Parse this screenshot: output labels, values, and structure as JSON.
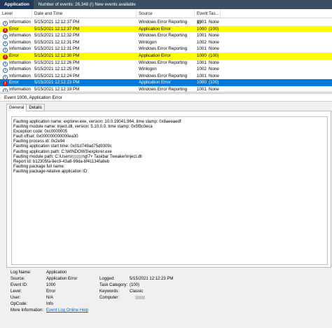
{
  "topbar": {
    "name": "Application",
    "info": "Number of events: 26,348 (!) New events available"
  },
  "columns": {
    "level": "Level",
    "date": "Date and Time",
    "source": "Source",
    "event_id": "Event ID",
    "task": "Tas..."
  },
  "events": [
    {
      "level": "Information",
      "icon": "info-icon",
      "date": "5/15/2021 12:12:37 PM",
      "source": "Windows Error Reporting",
      "id": "1001",
      "task": "None",
      "state": "normal"
    },
    {
      "level": "Error",
      "icon": "error-icon",
      "date": "5/15/2021 12:12:37 PM",
      "source": "Application Error",
      "id": "1000",
      "task": "(100)",
      "state": "yellow"
    },
    {
      "level": "Information",
      "icon": "info-icon",
      "date": "5/15/2021 12:12:32 PM",
      "source": "Windows Error Reporting",
      "id": "1001",
      "task": "None",
      "state": "normal"
    },
    {
      "level": "Information",
      "icon": "info-icon",
      "date": "5/15/2021 12:12:31 PM",
      "source": "Winlogon",
      "id": "1002",
      "task": "None",
      "state": "normal"
    },
    {
      "level": "Information",
      "icon": "info-icon",
      "date": "5/15/2021 12:12:31 PM",
      "source": "Windows Error Reporting",
      "id": "1001",
      "task": "None",
      "state": "normal"
    },
    {
      "level": "Error",
      "icon": "error-icon",
      "date": "5/15/2021 12:12:30 PM",
      "source": "Application Error",
      "id": "1000",
      "task": "(100)",
      "state": "yellow"
    },
    {
      "level": "Information",
      "icon": "info-icon",
      "date": "5/15/2021 12:12:26 PM",
      "source": "Windows Error Reporting",
      "id": "1001",
      "task": "None",
      "state": "normal"
    },
    {
      "level": "Information",
      "icon": "info-icon",
      "date": "5/15/2021 12:12:25 PM",
      "source": "Winlogon",
      "id": "1002",
      "task": "None",
      "state": "normal"
    },
    {
      "level": "Information",
      "icon": "info-icon",
      "date": "5/15/2021 12:12:24 PM",
      "source": "Windows Error Reporting",
      "id": "1001",
      "task": "None",
      "state": "normal"
    },
    {
      "level": "Error",
      "icon": "error-icon",
      "date": "5/15/2021 12:12:23 PM",
      "source": "Application Error",
      "id": "1000",
      "task": "(100)",
      "state": "selected"
    },
    {
      "level": "Information",
      "icon": "info-icon",
      "date": "5/15/2021 12:12:19 PM",
      "source": "Windows Error Reporting",
      "id": "1001",
      "task": "None",
      "state": "normal"
    }
  ],
  "event_title": "Event 1000, Application Error",
  "tabs": [
    "General",
    "Details"
  ],
  "description": [
    "Faulting application name: explorer.exe, version: 10.0.19041.964, time stamp: 0x8aeeaedf",
    "Faulting module name: inject.dll, version: 5.10.0.0, time stamp: 0x5f9c0eca",
    "Exception code: 0xc0000005",
    "Fault offset: 0x000000000000ea30",
    "Faulting process id: 0x2e94",
    "Faulting application start time: 0x01d749ad75d9309c",
    "Faulting application path: C:\\WINDOWS\\explorer.exe",
    "Faulting module path: C:\\Users\\",
    "Report Id: b12305fa-9ec9-43a8-99da-bf41134fa8eb",
    "Faulting package full name:",
    "Faulting package-relative application ID:"
  ],
  "module_path_suffix": "ng\\7+ Taskbar Tweaker\\inject.dll",
  "props": {
    "log_name_label": "Log Name:",
    "log_name": "Application",
    "source_label": "Source:",
    "source": "Application Error",
    "logged_label": "Logged:",
    "logged": "5/15/2021 12:12:23 PM",
    "event_id_label": "Event ID:",
    "event_id": "1000",
    "task_label": "Task Category:",
    "task": "(100)",
    "level_label": "Level:",
    "level": "Error",
    "keywords_label": "Keywords:",
    "keywords": "Classic",
    "user_label": "User:",
    "user": "N/A",
    "computer_label": "Computer:",
    "opcode_label": "OpCode:",
    "opcode": "Info",
    "more_label": "More Information:",
    "more_link": "Event Log Online Help"
  }
}
